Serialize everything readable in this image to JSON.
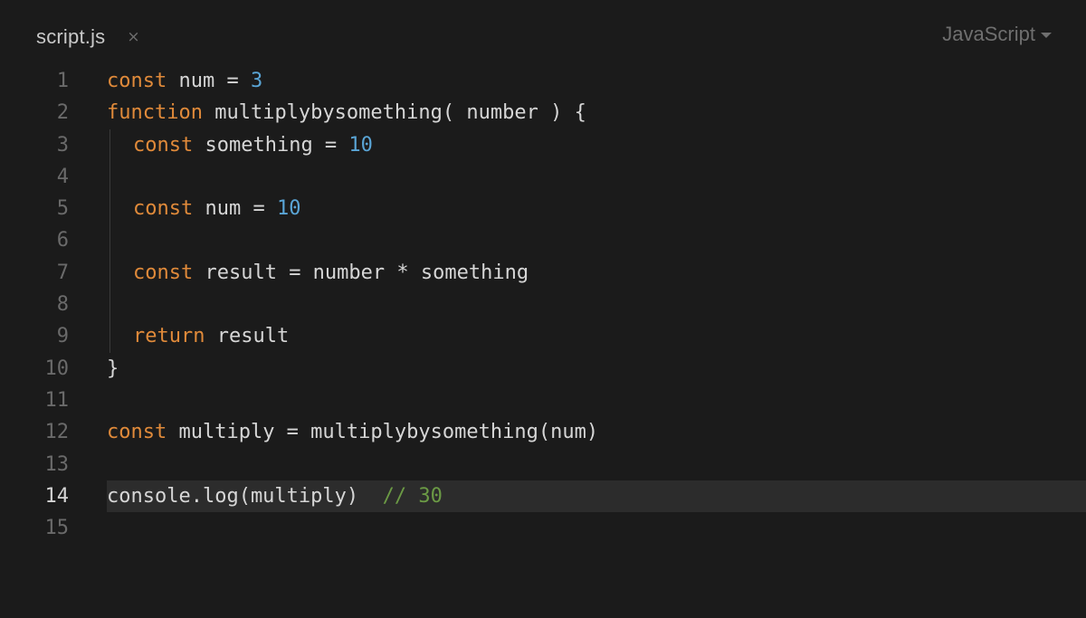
{
  "tab": {
    "title": "script.js",
    "close_glyph": "×"
  },
  "language": {
    "label": "JavaScript"
  },
  "colors": {
    "background": "#1b1b1b",
    "keyword": "#e08a3a",
    "number": "#5aa5d6",
    "comment": "#6b9a45",
    "text": "#d6d6d6",
    "line_number": "#6a6a6a",
    "active_line": "#2c2c2c"
  },
  "editor": {
    "active_line": 14,
    "lines": [
      {
        "n": "1",
        "indent": false,
        "tokens": [
          {
            "t": "const",
            "c": "kw"
          },
          {
            "t": " num = ",
            "c": "pl"
          },
          {
            "t": "3",
            "c": "num"
          }
        ]
      },
      {
        "n": "2",
        "indent": false,
        "tokens": [
          {
            "t": "function",
            "c": "kw"
          },
          {
            "t": " multiplybysomething( number ) {",
            "c": "pl"
          }
        ]
      },
      {
        "n": "3",
        "indent": true,
        "tokens": [
          {
            "t": "const",
            "c": "kw"
          },
          {
            "t": " something = ",
            "c": "pl"
          },
          {
            "t": "10",
            "c": "num"
          }
        ]
      },
      {
        "n": "4",
        "indent": true,
        "tokens": []
      },
      {
        "n": "5",
        "indent": true,
        "tokens": [
          {
            "t": "const",
            "c": "kw"
          },
          {
            "t": " num = ",
            "c": "pl"
          },
          {
            "t": "10",
            "c": "num"
          }
        ]
      },
      {
        "n": "6",
        "indent": true,
        "tokens": []
      },
      {
        "n": "7",
        "indent": true,
        "tokens": [
          {
            "t": "const",
            "c": "kw"
          },
          {
            "t": " result = number * something",
            "c": "pl"
          }
        ]
      },
      {
        "n": "8",
        "indent": true,
        "tokens": []
      },
      {
        "n": "9",
        "indent": true,
        "tokens": [
          {
            "t": "return",
            "c": "kw"
          },
          {
            "t": " result",
            "c": "pl"
          }
        ]
      },
      {
        "n": "10",
        "indent": false,
        "tokens": [
          {
            "t": "}",
            "c": "pl"
          }
        ]
      },
      {
        "n": "11",
        "indent": false,
        "tokens": []
      },
      {
        "n": "12",
        "indent": false,
        "tokens": [
          {
            "t": "const",
            "c": "kw"
          },
          {
            "t": " multiply = multiplybysomething(num)",
            "c": "pl"
          }
        ]
      },
      {
        "n": "13",
        "indent": false,
        "tokens": []
      },
      {
        "n": "14",
        "indent": false,
        "tokens": [
          {
            "t": "console.log(multiply)  ",
            "c": "pl"
          },
          {
            "t": "// 30",
            "c": "cm"
          }
        ]
      },
      {
        "n": "15",
        "indent": false,
        "tokens": []
      }
    ]
  }
}
